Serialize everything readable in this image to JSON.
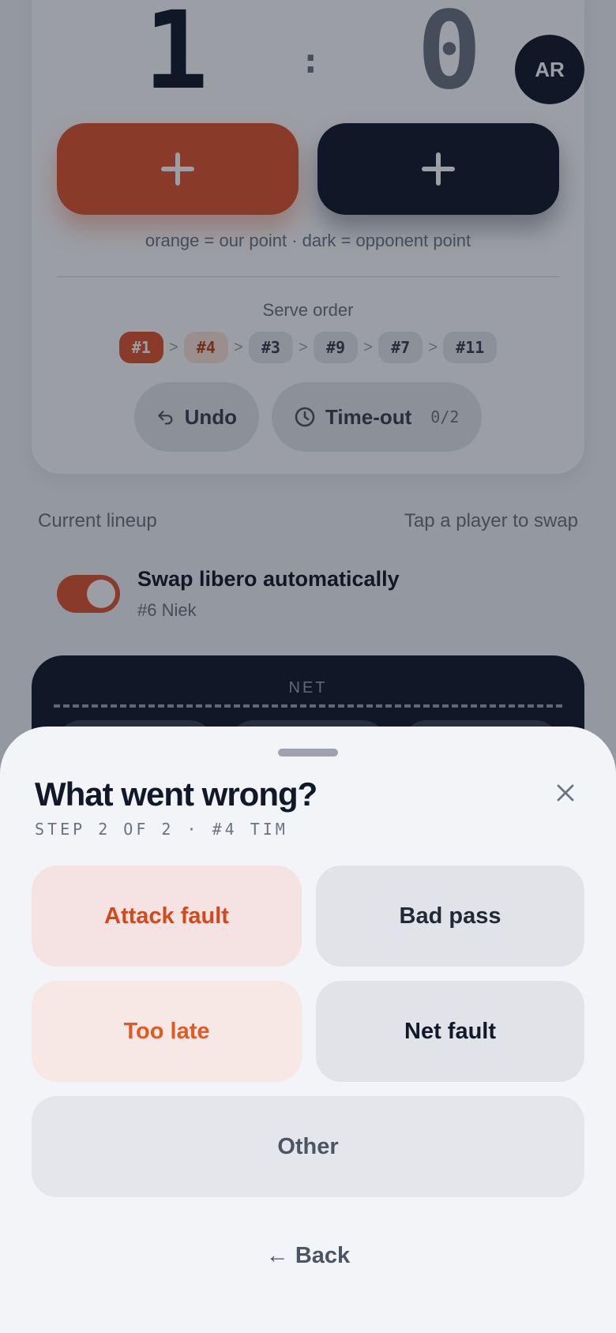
{
  "score": {
    "home": "1",
    "separator": ":",
    "away": "0"
  },
  "avatar": {
    "initials": "AR"
  },
  "point_buttons": {
    "home_label": "+",
    "away_label": "+"
  },
  "hint": "orange = our point · dark = opponent point",
  "serve": {
    "title": "Serve order",
    "order": [
      "#1",
      "#4",
      "#3",
      "#9",
      "#7",
      "#11"
    ],
    "separator": ">"
  },
  "actions": {
    "undo": "Undo",
    "timeout": "Time-out",
    "timeout_count": "0/2"
  },
  "lineup": {
    "title": "Current lineup",
    "hint": "Tap a player to swap"
  },
  "libero_toggle": {
    "label": "Swap libero automatically",
    "player": "#6 Niek",
    "on": true
  },
  "court": {
    "net_label": "NET"
  },
  "colors": {
    "accent": "#e0532a",
    "dark": "#111827",
    "sheet_bg": "#f3f4f8"
  },
  "sheet": {
    "title": "What went wrong?",
    "step": "STEP 2 OF 2 · #4 TIM",
    "close_icon": "close-icon",
    "options": {
      "attack_fault": "Attack fault",
      "bad_pass": "Bad pass",
      "too_late": "Too late",
      "net_fault": "Net fault",
      "other": "Other"
    },
    "back": "← Back"
  }
}
